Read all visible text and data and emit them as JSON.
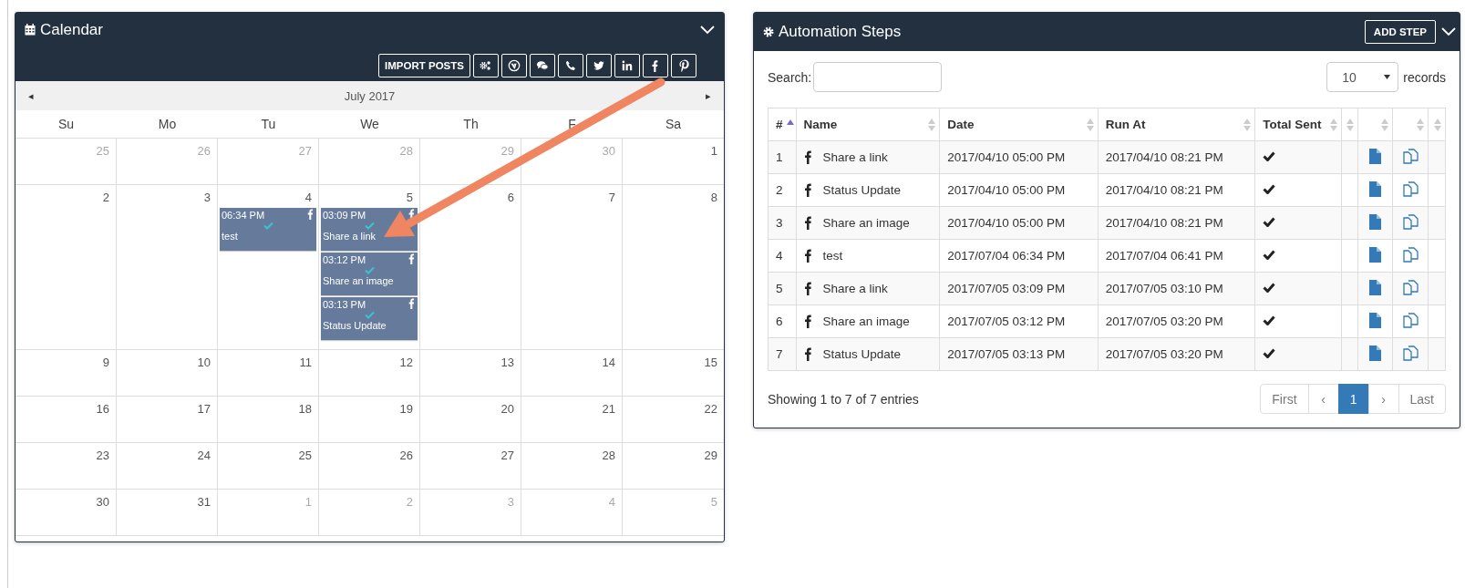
{
  "calendar": {
    "title": "Calendar",
    "import_label": "IMPORT POSTS",
    "month": "July 2017",
    "nav_prev": "◂",
    "nav_next": "▸",
    "weekdays": [
      "Su",
      "Mo",
      "Tu",
      "We",
      "Th",
      "F",
      "Sa"
    ],
    "weeks": [
      [
        {
          "day": "25",
          "outside": true
        },
        {
          "day": "26",
          "outside": true
        },
        {
          "day": "27",
          "outside": true
        },
        {
          "day": "28",
          "outside": true
        },
        {
          "day": "29",
          "outside": true
        },
        {
          "day": "30",
          "outside": true
        },
        {
          "day": "1",
          "outside": false
        }
      ],
      [
        {
          "day": "2",
          "outside": false
        },
        {
          "day": "3",
          "outside": false
        },
        {
          "day": "4",
          "outside": false,
          "events": [
            {
              "time": "06:34 PM",
              "title": "test"
            }
          ]
        },
        {
          "day": "5",
          "outside": false,
          "events": [
            {
              "time": "03:09 PM",
              "title": "Share a link"
            },
            {
              "time": "03:12 PM",
              "title": "Share an image"
            },
            {
              "time": "03:13 PM",
              "title": "Status Update"
            }
          ]
        },
        {
          "day": "6",
          "outside": false
        },
        {
          "day": "7",
          "outside": false
        },
        {
          "day": "8",
          "outside": false
        }
      ],
      [
        {
          "day": "9",
          "outside": false
        },
        {
          "day": "10",
          "outside": false
        },
        {
          "day": "11",
          "outside": false
        },
        {
          "day": "12",
          "outside": false
        },
        {
          "day": "13",
          "outside": false
        },
        {
          "day": "14",
          "outside": false
        },
        {
          "day": "15",
          "outside": false
        }
      ],
      [
        {
          "day": "16",
          "outside": false
        },
        {
          "day": "17",
          "outside": false
        },
        {
          "day": "18",
          "outside": false
        },
        {
          "day": "19",
          "outside": false
        },
        {
          "day": "20",
          "outside": false
        },
        {
          "day": "21",
          "outside": false
        },
        {
          "day": "22",
          "outside": false
        }
      ],
      [
        {
          "day": "23",
          "outside": false
        },
        {
          "day": "24",
          "outside": false
        },
        {
          "day": "25",
          "outside": false
        },
        {
          "day": "26",
          "outside": false
        },
        {
          "day": "27",
          "outside": false
        },
        {
          "day": "28",
          "outside": false
        },
        {
          "day": "29",
          "outside": false
        }
      ],
      [
        {
          "day": "30",
          "outside": false
        },
        {
          "day": "31",
          "outside": false
        },
        {
          "day": "1",
          "outside": true
        },
        {
          "day": "2",
          "outside": true
        },
        {
          "day": "3",
          "outside": true
        },
        {
          "day": "4",
          "outside": true
        },
        {
          "day": "5",
          "outside": true
        }
      ]
    ]
  },
  "automation_steps": {
    "title": "Automation Steps",
    "add_button": "ADD STEP",
    "search_label": "Search:",
    "page_size": "10",
    "records_label": "records",
    "columns": [
      {
        "label": "#",
        "sorted": true
      },
      {
        "label": "Name",
        "sorted": false
      },
      {
        "label": "Date",
        "sorted": false
      },
      {
        "label": "Run At",
        "sorted": false
      },
      {
        "label": "Total Sent",
        "sorted": false
      },
      {
        "sorted": false
      },
      {
        "sorted": false
      },
      {
        "sorted": false
      },
      {
        "sorted": false
      }
    ],
    "rows": [
      {
        "number": "1",
        "name": "Share a link",
        "date": "2017/04/10 05:00 PM",
        "run_at": "2017/04/10 08:21 PM",
        "sent": true
      },
      {
        "number": "2",
        "name": "Status Update",
        "date": "2017/04/10 05:00 PM",
        "run_at": "2017/04/10 08:21 PM",
        "sent": true
      },
      {
        "number": "3",
        "name": "Share an image",
        "date": "2017/04/10 05:00 PM",
        "run_at": "2017/04/10 08:21 PM",
        "sent": true
      },
      {
        "number": "4",
        "name": "test",
        "date": "2017/07/04 06:34 PM",
        "run_at": "2017/07/04 06:41 PM",
        "sent": true
      },
      {
        "number": "5",
        "name": "Share a link",
        "date": "2017/07/05 03:09 PM",
        "run_at": "2017/07/05 03:10 PM",
        "sent": true
      },
      {
        "number": "6",
        "name": "Share an image",
        "date": "2017/07/05 03:12 PM",
        "run_at": "2017/07/05 03:20 PM",
        "sent": true
      },
      {
        "number": "7",
        "name": "Status Update",
        "date": "2017/07/05 03:13 PM",
        "run_at": "2017/07/05 03:20 PM",
        "sent": true
      }
    ],
    "info": "Showing 1 to 7 of 7 entries",
    "pages": [
      {
        "label": "First",
        "selected": false
      },
      {
        "label": "‹",
        "selected": false
      },
      {
        "label": "1",
        "selected": true
      },
      {
        "label": "›",
        "selected": false
      },
      {
        "label": "Last",
        "selected": false
      }
    ]
  }
}
